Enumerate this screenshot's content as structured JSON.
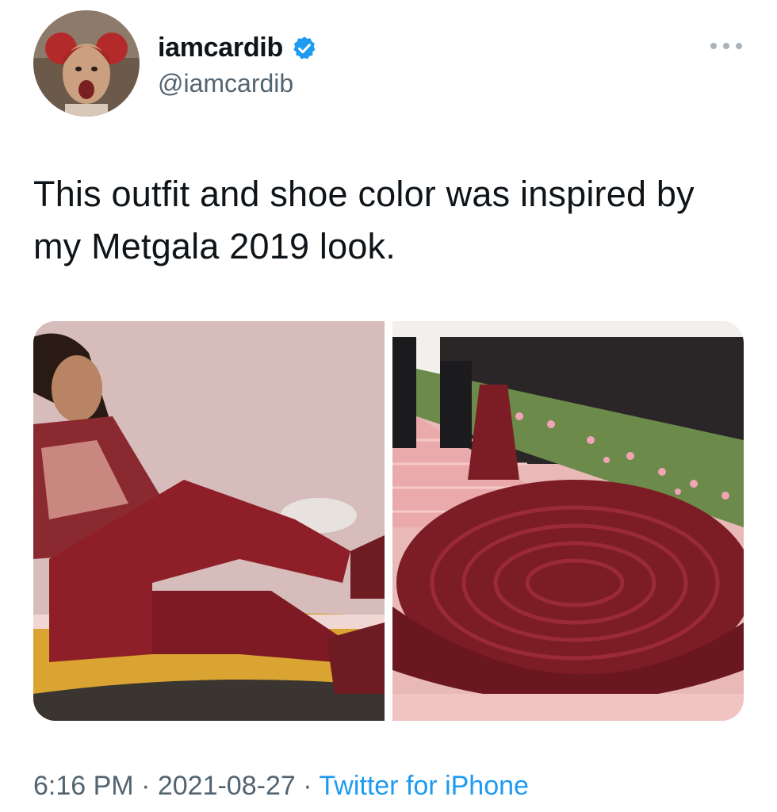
{
  "author": {
    "display_name": "iamcardib",
    "handle": "@iamcardib",
    "verified": true,
    "badge_color": "#1d9bf0"
  },
  "more_icon": "more-horizontal-icon",
  "tweet": {
    "text": "This outfit and shoe color was inspired by my Metgala 2019 look."
  },
  "meta": {
    "time": "6:16 PM",
    "separator": " · ",
    "date": "2021-08-27",
    "source": "Twitter for iPhone"
  },
  "colors": {
    "text": "#0f1419",
    "secondary": "#536471",
    "link": "#1d9bf0"
  }
}
